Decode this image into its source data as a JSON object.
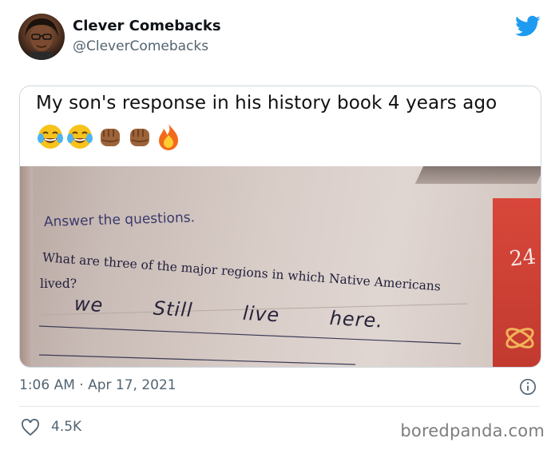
{
  "author": {
    "name": "Clever Comebacks",
    "handle": "@CleverComebacks"
  },
  "icons": {
    "brand": "twitter-bird-icon",
    "info": "info-icon",
    "like": "heart-icon"
  },
  "colors": {
    "twitter_blue": "#1d9bf0",
    "secondary_text": "#536471",
    "border": "#cfd9de"
  },
  "media": {
    "caption": "My son's response in his history book 4 years ago",
    "emojis": [
      "tears-of-joy",
      "tears-of-joy",
      "raised-fist",
      "raised-fist",
      "fire"
    ],
    "photo": {
      "instruction": "Answer the questions.",
      "question_line1": "What are three of the major regions in which Native Americans",
      "question_line2": "lived?",
      "handwritten_answer": [
        "we",
        "Still",
        "live",
        "here."
      ],
      "page_number": "24"
    }
  },
  "timestamp": "1:06 AM · Apr 17, 2021",
  "likes": "4.5K",
  "watermark": "boredpanda.com"
}
